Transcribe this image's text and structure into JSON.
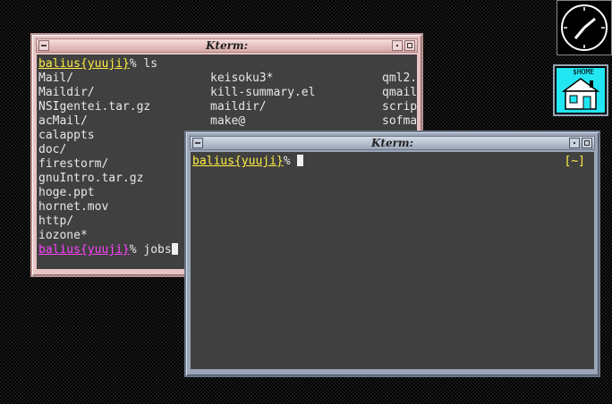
{
  "desktop": {
    "clock_icon": "analog-clock-icon",
    "home_icon": {
      "icon": "home-folder-icon",
      "label": "$HOME"
    }
  },
  "window1": {
    "title": "Kterm:",
    "prompt": "balius{yuuji}",
    "prompt_suffix": "% ",
    "command": "ls",
    "listing_col1": [
      "Mail/",
      "Maildir/",
      "NSIgentei.tar.gz",
      "acMail/",
      "calappts",
      "doc/",
      "firestorm/",
      "gnuIntro.tar.gz",
      "hoge.ppt",
      "hornet.mov",
      "http/",
      "iozone*"
    ],
    "listing_col2": [
      "keisoku3*",
      "kill-summary.el",
      "maildir/",
      "make@"
    ],
    "listing_col3": [
      "qml2.",
      "qmail",
      "scrip",
      "sofma"
    ],
    "prompt2_suffix": "% ",
    "command2": "jobs"
  },
  "window2": {
    "title": "Kterm:",
    "prompt": "balius{yuuji}",
    "prompt_suffix": "% ",
    "tag": "[~]"
  }
}
